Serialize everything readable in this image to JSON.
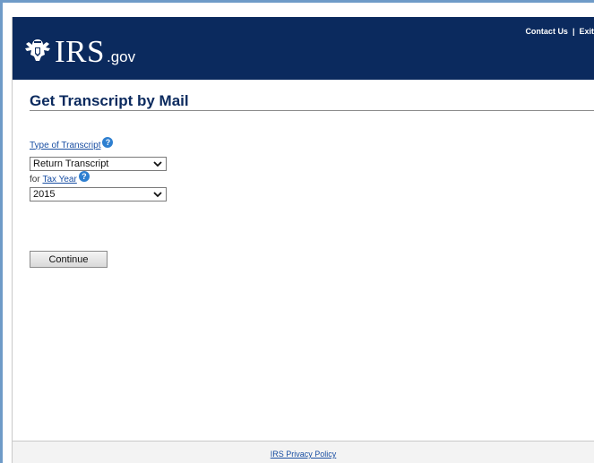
{
  "header": {
    "logo_main": "IRS",
    "logo_sub": ".gov",
    "contact_label": "Contact Us",
    "separator": "|",
    "exit_label": "Exit"
  },
  "page": {
    "title": "Get Transcript by Mail"
  },
  "form": {
    "type_label": "Type of Transcript",
    "type_value": "Return Transcript",
    "for_prefix": "for",
    "year_label": "Tax Year",
    "year_value": "2015",
    "continue_label": "Continue"
  },
  "footer": {
    "privacy_label": "IRS Privacy Policy"
  },
  "icons": {
    "help": "question-circle-icon",
    "dropdown": "chevron-down-icon",
    "logo": "eagle-icon"
  },
  "colors": {
    "header_bg": "#0b2a5e",
    "title": "#0b2a5e",
    "link": "#1a4fa3",
    "help_icon": "#2e7fd0",
    "frame_border": "#6f9bc8"
  }
}
